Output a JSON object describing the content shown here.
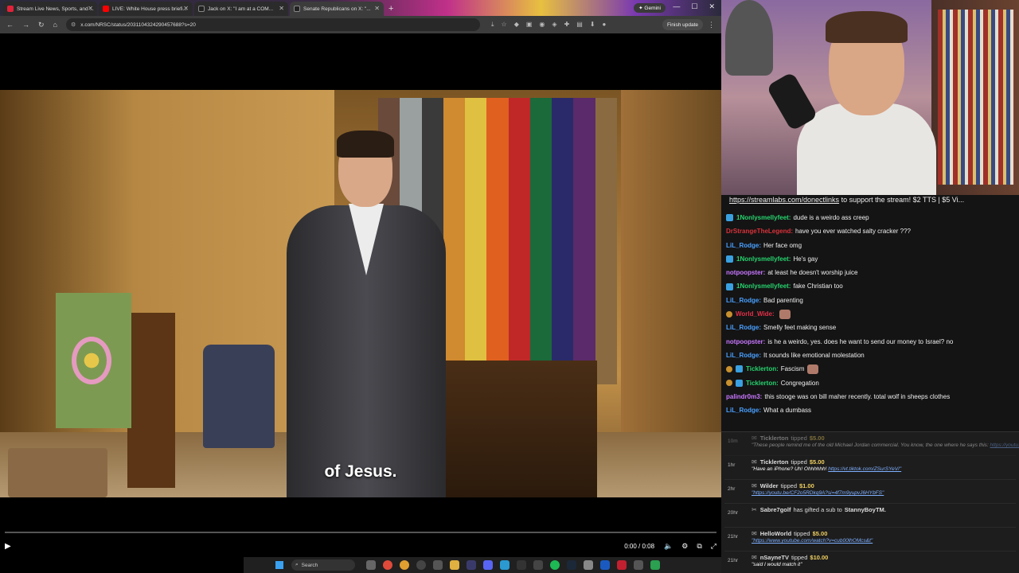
{
  "browser": {
    "tabs": [
      {
        "title": "Stream Live News, Sports, and ...",
        "favicon_color": "#e0223a"
      },
      {
        "title": "LIVE: White House press briefi...",
        "favicon_color": "#ff0000"
      },
      {
        "title": "Jack on X: \"I am at a COM...",
        "favicon_color": "#222222"
      },
      {
        "title": "Senate Republicans on X: \"...",
        "favicon_color": "#222222"
      }
    ],
    "new_tab": "+",
    "gemini_label": "Gemini",
    "url": "x.com/NRSC/status/2031104324290457688?s=20",
    "finish_update": "Finish update"
  },
  "video": {
    "subtitle": "of Jesus.",
    "time": "0:00 / 0:08",
    "progress": 0.0
  },
  "taskbar": {
    "search_placeholder": "Search"
  },
  "chat": {
    "donate_link": "https://streamlabs.com/donectlinks",
    "donate_text": " to support the stream! $2 TTS | $5 Vi...",
    "messages": [
      {
        "user": "1Nonlysmellyfeet:",
        "color": "#27d36e",
        "badge": "blue",
        "text": "dude is a weirdo ass creep"
      },
      {
        "user": "DrStrangeTheLegend:",
        "color": "#d8323a",
        "badge": "",
        "text": "have you ever watched salty cracker ???"
      },
      {
        "user": "LiL_Rodge:",
        "color": "#4aa0ff",
        "badge": "",
        "text": "Her face omg"
      },
      {
        "user": "1Nonlysmellyfeet:",
        "color": "#27d36e",
        "badge": "blue",
        "text": "He's gay"
      },
      {
        "user": "notpoopster:",
        "color": "#c978ff",
        "badge": "",
        "text": "at least he doesn't worship juice"
      },
      {
        "user": "1Nonlysmellyfeet:",
        "color": "#27d36e",
        "badge": "blue",
        "text": "fake Christian too"
      },
      {
        "user": "LiL_Rodge:",
        "color": "#4aa0ff",
        "badge": "",
        "text": "Bad parenting"
      },
      {
        "user": "World_Wide:",
        "color": "#e03048",
        "badge": "gold",
        "text": "",
        "emote": true
      },
      {
        "user": "LiL_Rodge:",
        "color": "#4aa0ff",
        "badge": "",
        "text": "Smelly feet making sense"
      },
      {
        "user": "notpoopster:",
        "color": "#c978ff",
        "badge": "",
        "text": "is he a weirdo, yes. does he want to send our money to Israel? no"
      },
      {
        "user": "LiL_Rodge:",
        "color": "#4aa0ff",
        "badge": "",
        "text": "It sounds like emotional molestation"
      },
      {
        "user": "Ticklerton:",
        "color": "#27d36e",
        "badge": "goldblue",
        "text": "Fascism",
        "emote": true
      },
      {
        "user": "Ticklerton:",
        "color": "#27d36e",
        "badge": "goldblue",
        "text": "Congregation"
      },
      {
        "user": "palindr0m3:",
        "color": "#c978ff",
        "badge": "",
        "text": "this stooge was on bill maher recently. total wolf in sheeps clothes"
      },
      {
        "user": "LiL_Rodge:",
        "color": "#4aa0ff",
        "badge": "",
        "text": "What a dumbass"
      }
    ]
  },
  "donations": [
    {
      "age": "10m",
      "name": "Ticklerton",
      "action": "tipped",
      "amount": "$5.00",
      "message": "These people remind me of the old Michael Jordan commercial. You know, the one where he says this:",
      "link": "https://youtu.be/9Dwq7VhtrfbM?si=SUbxoX9WyI4PX8S",
      "dim": true
    },
    {
      "age": "1hr",
      "name": "Ticklerton",
      "action": "tipped",
      "amount": "$5.00",
      "message": "Have an iPhone? Uh! Ohhhhhh!",
      "link": "https://vt.tiktok.com/ZSurSYeV/",
      "dim": false
    },
    {
      "age": "2hr",
      "name": "Wilder",
      "action": "tipped",
      "amount": "$1.00",
      "message": "",
      "link": "https://youtu.be/CF2o5RDkq9A?si=4f7m9yupvJ6HYbFS",
      "dim": false
    },
    {
      "age": "20hr",
      "name": "Sabre7golf",
      "action": "has gifted a sub to",
      "amount": "StannyBoyTM.",
      "message": "",
      "link": "",
      "dim": false
    },
    {
      "age": "21hr",
      "name": "HelloWorld",
      "action": "tipped",
      "amount": "$5.00",
      "message": "",
      "link": "https://www.youtube.com/watch?v=cub00lhOMcs&t",
      "dim": false
    },
    {
      "age": "21hr",
      "name": "nSayneTV",
      "action": "tipped",
      "amount": "$10.00",
      "message": "said I would match it",
      "link": "",
      "dim": false
    }
  ]
}
